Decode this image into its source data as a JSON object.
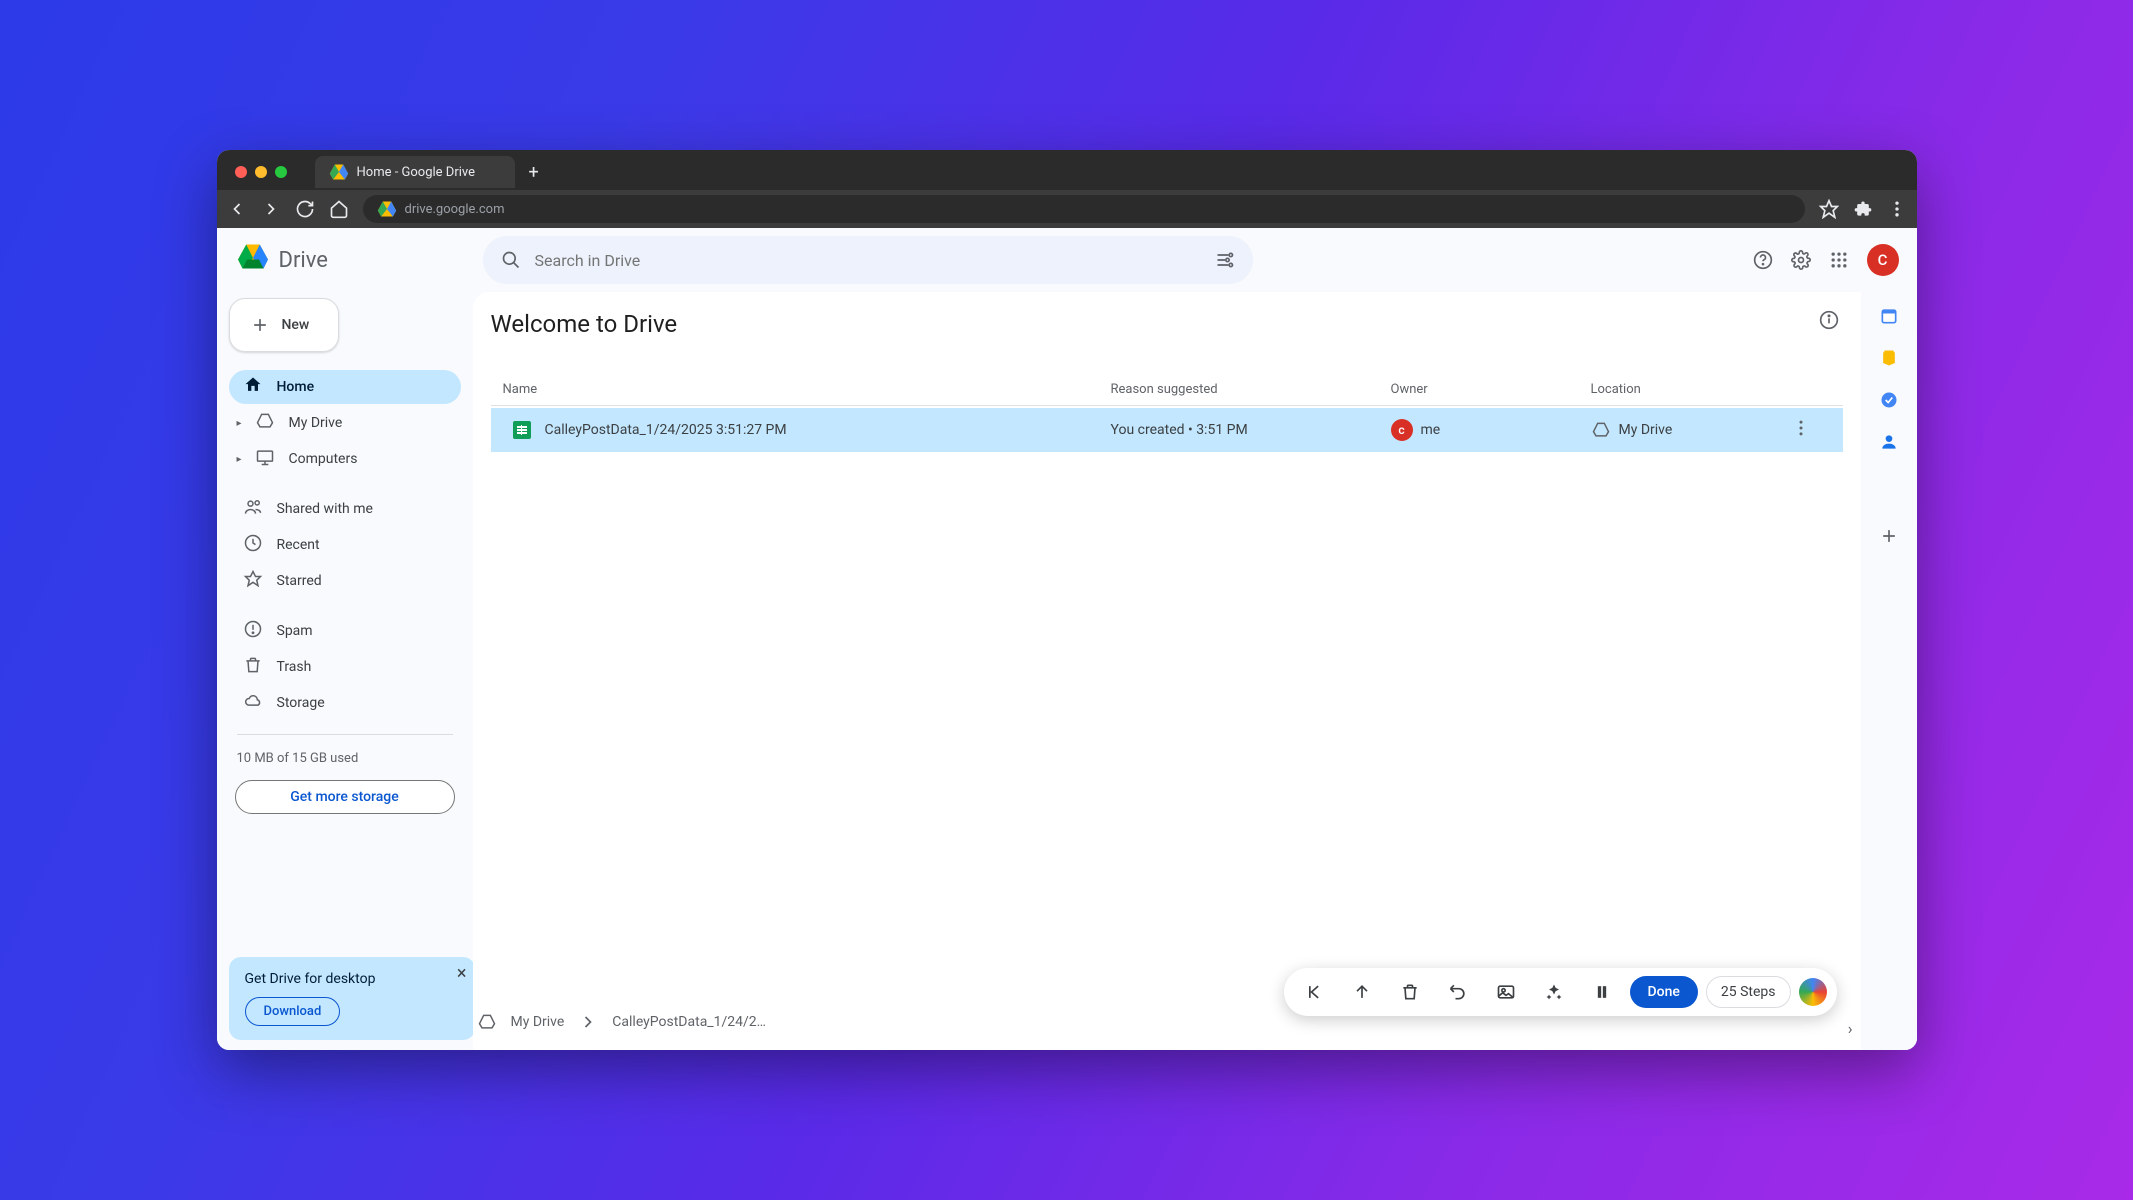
{
  "browser": {
    "tab_title": "Home - Google Drive",
    "url": "drive.google.com"
  },
  "app": {
    "name": "Drive",
    "avatar_letter": "C",
    "search_placeholder": "Search in Drive"
  },
  "sidebar": {
    "new_label": "New",
    "items": [
      {
        "label": "Home",
        "active": true
      },
      {
        "label": "My Drive",
        "active": false,
        "expandable": true
      },
      {
        "label": "Computers",
        "active": false,
        "expandable": true
      }
    ],
    "items2": [
      {
        "label": "Shared with me"
      },
      {
        "label": "Recent"
      },
      {
        "label": "Starred"
      }
    ],
    "items3": [
      {
        "label": "Spam"
      },
      {
        "label": "Trash"
      },
      {
        "label": "Storage"
      }
    ],
    "storage_text": "10 MB of 15 GB used",
    "storage_button": "Get more storage"
  },
  "desktop_card": {
    "title": "Get Drive for desktop",
    "button": "Download"
  },
  "main": {
    "title": "Welcome to Drive",
    "columns": {
      "name": "Name",
      "reason": "Reason suggested",
      "owner": "Owner",
      "location": "Location"
    },
    "row": {
      "filename": "CalleyPostData_1/24/2025 3:51:27 PM",
      "reason": "You created • 3:51 PM",
      "owner_letter": "c",
      "owner": "me",
      "location": "My Drive"
    }
  },
  "breadcrumb": {
    "root": "My Drive",
    "current": "CalleyPostData_1/24/2…"
  },
  "toolbar": {
    "done": "Done",
    "steps": "25 Steps"
  }
}
